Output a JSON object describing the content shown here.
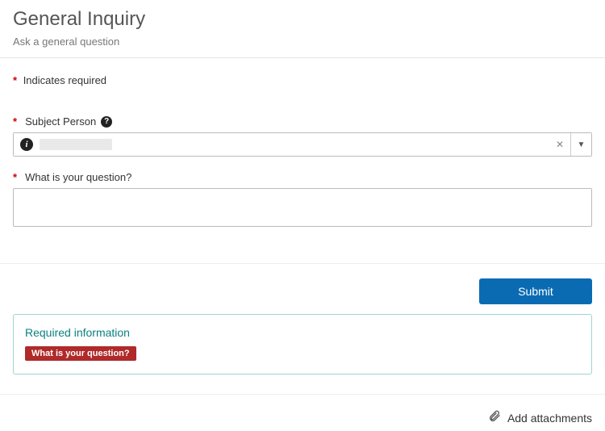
{
  "header": {
    "title": "General Inquiry",
    "subtitle": "Ask a general question"
  },
  "form": {
    "required_legend": "Indicates required",
    "subject_person": {
      "label": "Subject Person",
      "value": ""
    },
    "question": {
      "label": "What is your question?",
      "value": ""
    }
  },
  "actions": {
    "submit_label": "Submit"
  },
  "errors": {
    "title": "Required information",
    "items": [
      "What is your question?"
    ]
  },
  "footer": {
    "attachments_label": "Add attachments"
  }
}
